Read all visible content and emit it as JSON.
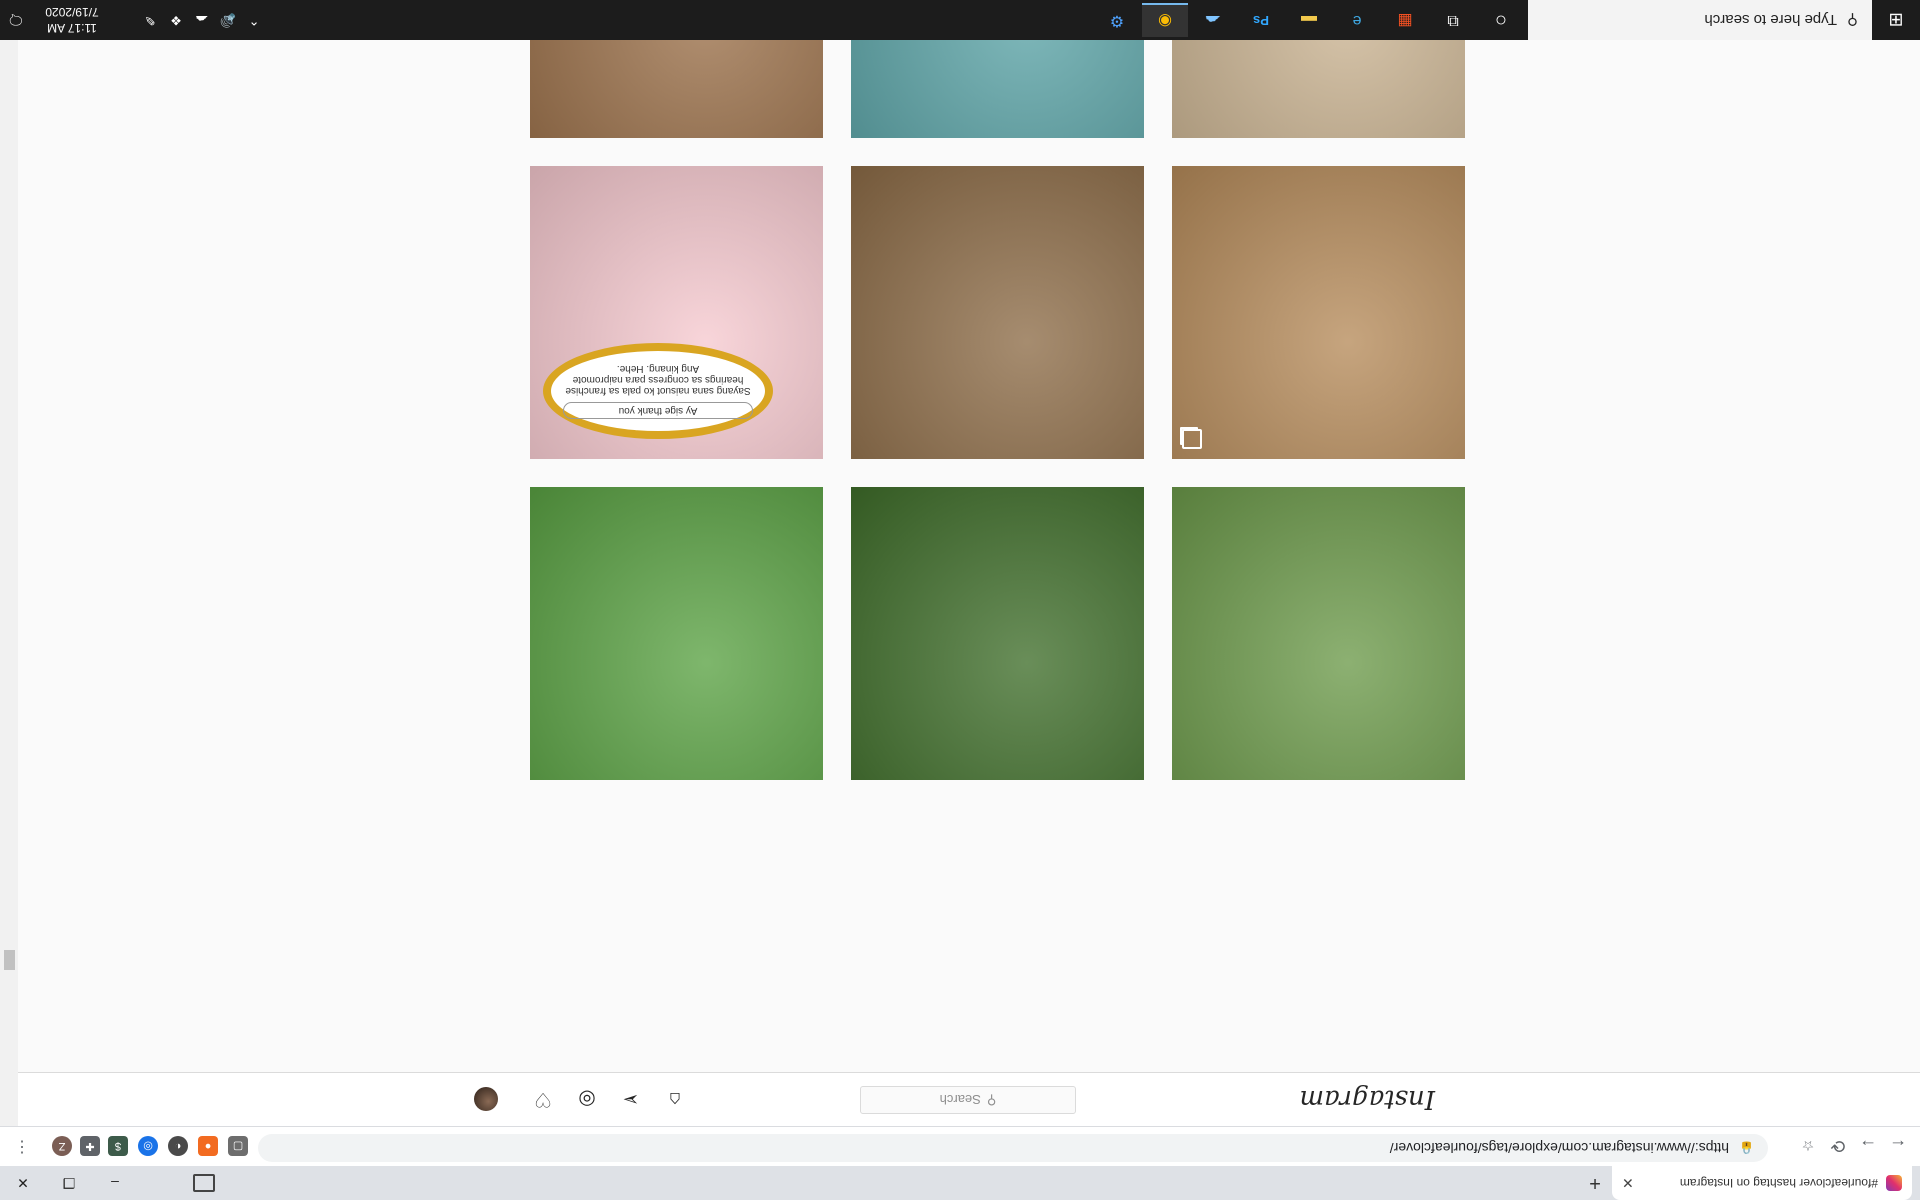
{
  "browser": {
    "tab_title": "#fourleafclover hashtag on Instagram",
    "new_tab": "+",
    "window_buttons": {
      "minimize": "–",
      "restore": "❐",
      "close": "✕"
    },
    "nav": {
      "back": "←",
      "forward": "→",
      "reload": "⟳"
    },
    "url": "https://www.instagram.com/explore/tags/fourleafclover/",
    "profile_initial": "Z",
    "menu": "⋮"
  },
  "instagram": {
    "logo": "Instagram",
    "search_placeholder": "Search",
    "search_glyph": "⚲",
    "nav_icons": [
      "home-icon",
      "direct-icon",
      "explore-icon",
      "activity-icon",
      "profile-avatar"
    ]
  },
  "grid": {
    "tiles": [
      {
        "name": "clover-in-hand",
        "bg": "#6c9a4a"
      },
      {
        "name": "clover-patch",
        "bg": "#3f6e2a"
      },
      {
        "name": "big-clover-closeup",
        "bg": "#5aa243"
      },
      {
        "name": "dog-with-clover",
        "bg": "#b68b5a",
        "multi": true
      },
      {
        "name": "clover-on-rock",
        "bg": "#8d6c47"
      },
      {
        "name": "earring-video",
        "bg": "#f6c9cf"
      },
      {
        "name": "child-drinking",
        "bg": "#c9b290"
      },
      {
        "name": "clover-pink-nails",
        "bg": "#5aa3a6"
      },
      {
        "name": "dog-eyes-closeup",
        "bg": "#9a6f48"
      }
    ],
    "earring_post_text": {
      "reply": "Ay sige thank you",
      "body": "Sayang sana naisuot ko pala sa franchise hearings sa congress para naipromote Ang kinang. Hehe."
    }
  },
  "taskbar": {
    "search_placeholder": "Type here to search",
    "clock_time": "11:17 AM",
    "clock_date": "7/19/2020",
    "start_icon": "⊞"
  }
}
